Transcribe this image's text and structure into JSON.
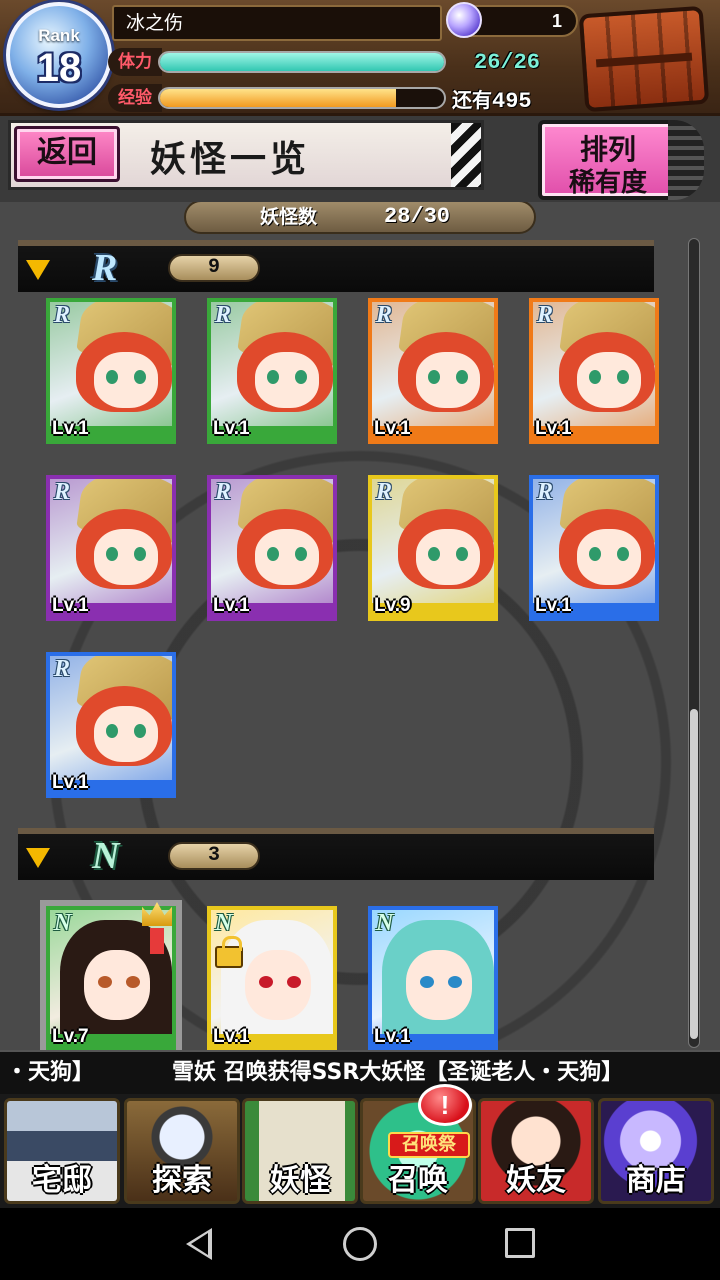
{
  "status": {
    "rank_label": "Rank",
    "rank_value": "18",
    "player_name": "冰之伤",
    "orb_count": "1",
    "stamina_label": "体力",
    "stamina_value": "26/26",
    "stamina_fraction": 1.0,
    "exp_label": "经验",
    "exp_remaining_prefix": "还有",
    "exp_remaining_value": "495",
    "exp_fraction": 0.83
  },
  "header": {
    "back_label": "返回",
    "title": "妖怪一览",
    "sort_line1": "排列",
    "sort_line2": "稀有度"
  },
  "collection": {
    "count_label": "妖怪数",
    "count_value": "28/30"
  },
  "sections": [
    {
      "rarity": "R",
      "count": "9",
      "cards": [
        {
          "level": "Lv.1",
          "frame": "#39a83a"
        },
        {
          "level": "Lv.1",
          "frame": "#39a83a"
        },
        {
          "level": "Lv.1",
          "frame": "#f07a18"
        },
        {
          "level": "Lv.1",
          "frame": "#f07a18"
        },
        {
          "level": "Lv.1",
          "frame": "#8a2fb0"
        },
        {
          "level": "Lv.1",
          "frame": "#8a2fb0"
        },
        {
          "level": "Lv.9",
          "frame": "#e8c81c"
        },
        {
          "level": "Lv.1",
          "frame": "#2a6ee8"
        },
        {
          "level": "Lv.1",
          "frame": "#2a6ee8"
        }
      ]
    },
    {
      "rarity": "N",
      "count": "3",
      "cards": [
        {
          "level": "Lv.7",
          "frame": "#39a83a"
        },
        {
          "level": "Lv.1",
          "frame": "#e8c81c"
        },
        {
          "level": "Lv.1",
          "frame": "#2a6ee8"
        }
      ]
    }
  ],
  "ticker": {
    "text_a": "・天狗】",
    "text_b": "雪妖 召唤获得SSR大妖怪【圣诞老人・天狗】"
  },
  "nav": {
    "home": "宅邸",
    "explore": "探索",
    "yokai": "妖怪",
    "summon": "召唤",
    "summon_tag": "召唤祭",
    "summon_badge": "!",
    "friends": "妖友",
    "shop": "商店"
  },
  "icons": {
    "rank": "pentagram-badge-icon",
    "orb": "crystal-orb-icon",
    "chest": "treasure-chest-icon",
    "expand": "triangle-down-icon",
    "mvp": "crown-medal-icon",
    "lock": "lock-icon"
  }
}
